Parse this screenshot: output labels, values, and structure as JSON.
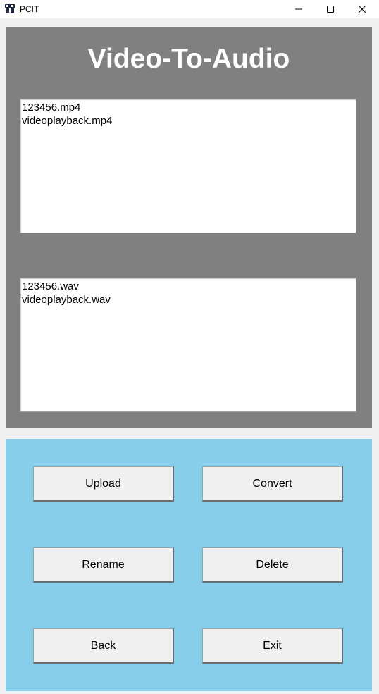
{
  "window": {
    "title": "PCIT",
    "controls": {
      "minimize_icon": "minimize-icon",
      "maximize_icon": "maximize-icon",
      "close_icon": "close-icon"
    }
  },
  "header": {
    "title": "Video-To-Audio"
  },
  "video_list": {
    "items": [
      "123456.mp4",
      "videoplayback.mp4"
    ]
  },
  "audio_list": {
    "items": [
      "123456.wav",
      "videoplayback.wav"
    ]
  },
  "buttons": {
    "upload": "Upload",
    "convert": "Convert",
    "rename": "Rename",
    "delete": "Delete",
    "back": "Back",
    "exit": "Exit"
  },
  "colors": {
    "top_panel": "#808080",
    "bottom_panel": "#87ceeb",
    "button_face": "#f0f0f0"
  }
}
